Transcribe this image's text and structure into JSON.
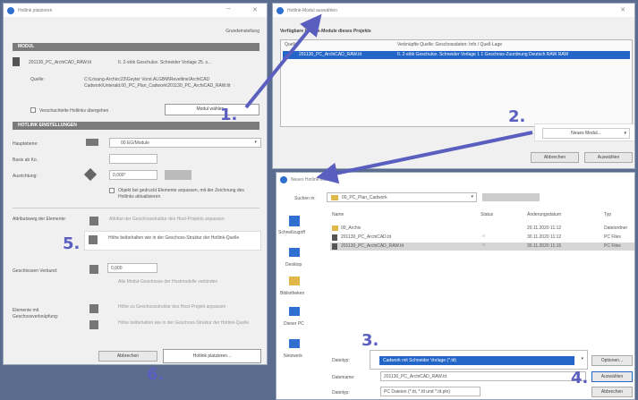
{
  "left_window": {
    "title": "Hotlink platzieren",
    "grundeinstellung": "Grundeinstellung",
    "section_modul": "MODUL",
    "module_name": "201130_PC_ArchiCAD_RAW.tit",
    "module_ver": "II. 2-stök Geschulce. Schneider Vorlage 25. s...",
    "source_label": "Quelle:",
    "source_path": "C:\\Lösung-Archicc23\\Geyter Vorst.ALGBM\\Reveltine\\ArchiCAD Cadwork\\Unterald.00_PC_Plan_Cadwork\\201130_PC_ArchiCAD_RAW.tit",
    "mark_copy": "Verschachtelte Hotlinks übergehen",
    "select_button": "Modul wählen...",
    "section_hotlink": "HOTLINK EINSTELLUNGEN",
    "hauptebene": "Hauptebene:",
    "hauptebene_val": "00 EG/Module",
    "basis_label": "Basis ab Ko.",
    "ausrichtung": "Ausrichtung:",
    "rotation_val": "0,000°",
    "spiegeln": "Objekt bei gedruckt Elemente anpassen, mit der Zeichnung des Hotlinks aktualisieren",
    "attrib_label": "Attributsweg der Elemente:",
    "attrib_opt1": "Attribut der Geschossstruktur des Host-Projekts anpassen",
    "attrib_opt2": "Höhe beibehalten wie in der Geschoss-Struktur der Hotlink-Quelle",
    "hoehen_label": "Geschlossen Verbund:",
    "hoehen_val": "0,000",
    "hoehen_desc": "Alle Modul-Geschosse der Hostmodelle verbinden",
    "elements_label": "Elemente mit Geschossverknüpfung:",
    "elem_opt1": "Höhe zu Geschossstruktur des Host-Projekt anpassen",
    "elem_opt2": "Höhe beibehalten wie in der Geschoss-Struktur der Hotlink-Quelle",
    "cancel": "Abbrechen",
    "place": "Hotlink platzieren..."
  },
  "top_right_window": {
    "title": "Hotlink-Modul auswählen",
    "heading": "Verfügbare Hotlink-Module dieses Projekts",
    "col_source": "Quelle",
    "col_info": "Verknüpfte Quelle: Geschossdaten: Info / Quell-Lage",
    "row_file": "201130_PC_ArchiCAD_RAW.tit",
    "row_info": "II. 2-stök Geschulce. Schneider Vorlage 1 1 Geschoss-Zuordnung Deutsch RAW RAW",
    "new_module": "Neues Modul...",
    "cancel": "Abbrechen",
    "select": "Auswählen"
  },
  "bottom_right_window": {
    "title": "Neues Hotlink-Modul",
    "search_label": "Suchen in:",
    "folder": "00_PC_Plan_Cadwork",
    "columns": [
      "Name",
      "Status",
      "Änderungsdatum",
      "Typ"
    ],
    "files": [
      {
        "name": "00_Archiv",
        "status": "",
        "date": "20.11.2020 11:12",
        "type": "Dateiordner"
      },
      {
        "name": "201130_PC_ArchiCAD.tit",
        "status": "○",
        "date": "30.11.2020 11:12",
        "type": "PC Files"
      },
      {
        "name": "201130_PC_ArchiCAD_RAW.tit",
        "status": "○",
        "date": "30.11.2020 11:15",
        "type": "PC Files"
      }
    ],
    "places": [
      "Schnellzugriff",
      "Desktop",
      "Bibliotheken",
      "Dieser PC",
      "Netzwerk"
    ],
    "filetype_label": "Dateityp:",
    "filetype_val": "Cadwork mit Schneider Vorlage (*.tit)",
    "filename_label": "Dateiname:",
    "filename_val": "201130_PC_ArchiCAD_RAW.tit",
    "attrib_label": "Dateityp:",
    "attrib_val": "PC Dateien (*.tit, *.ttl und *.tit.pln)",
    "options_btn": "Optionen...",
    "open_btn": "Auswählen",
    "cancel_btn": "Abbrechen"
  },
  "callouts": [
    "1.",
    "2.",
    "3.",
    "4.",
    "5.",
    "6."
  ],
  "colors": {
    "accent": "#5a5fbf",
    "selection": "#2466c8",
    "section": "#7b7b7b"
  }
}
